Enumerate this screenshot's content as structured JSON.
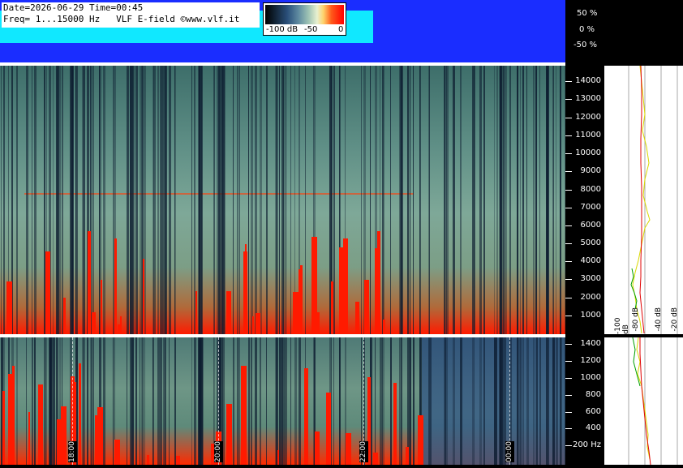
{
  "header": {
    "date_line": "Date=2026-06-29 Time=00:45",
    "freq_line": "Freq= 1...15000 Hz   VLF E-field ©www.vlf.it"
  },
  "colorbar": {
    "labels": [
      "-100 dB",
      "-50",
      "0"
    ]
  },
  "waveform_scale": [
    "50 %",
    "0 %",
    "-50 %"
  ],
  "upper_axis": {
    "ticks": [
      "14000",
      "13000",
      "12000",
      "11000",
      "10000",
      "9000",
      "8000",
      "7000",
      "6000",
      "5000",
      "4000",
      "3000",
      "2000",
      "1000"
    ]
  },
  "lower_axis": {
    "ticks": [
      "1400",
      "1200",
      "1000",
      "800",
      "600",
      "400",
      "200 Hz"
    ]
  },
  "time_markers": [
    "18:00",
    "20:00",
    "22:00",
    "00:00"
  ],
  "profile_db_labels": [
    "-100 dB",
    "-80 dB",
    "-40 dB",
    "-20 dB"
  ],
  "colors": {
    "waveform_blue": "#1a2dff",
    "waveform_cyan": "#10e8ff",
    "spectrogram_hot": "#ff1a00",
    "profile_red": "#e00000",
    "profile_yellow": "#d8d800",
    "profile_green": "#00a000"
  }
}
